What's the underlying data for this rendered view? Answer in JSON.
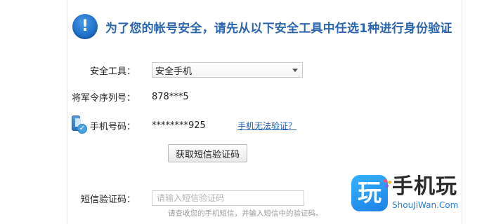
{
  "header": {
    "title": "为了您的帐号安全，请先从以下安全工具中任选1种进行身份验证",
    "icon": "exclamation-icon",
    "title_color": "#2b66ad",
    "icon_color": "#1f6fc9"
  },
  "form": {
    "tool": {
      "label": "安全工具：",
      "selected": "安全手机"
    },
    "serial": {
      "label": "将军令序列号：",
      "value": "878***5"
    },
    "phone": {
      "label": "手机号码：",
      "value": "********925",
      "link": "手机无法验证？",
      "icon": "phone-check-icon"
    },
    "get_code_button": "获取短信验证码",
    "sms": {
      "label": "短信验证码：",
      "placeholder": "请输入短信验证码",
      "hint": "请查收您的手机短信，并输入短信中的验证码。"
    }
  },
  "watermark": {
    "badge_char": "玩",
    "text": "手机玩",
    "sub": "ShouJiWan.Com",
    "badge_color": "#1e80e6",
    "dot_colors": [
      "#ff4b6e",
      "#ffc03a",
      "#7a5cff"
    ]
  }
}
